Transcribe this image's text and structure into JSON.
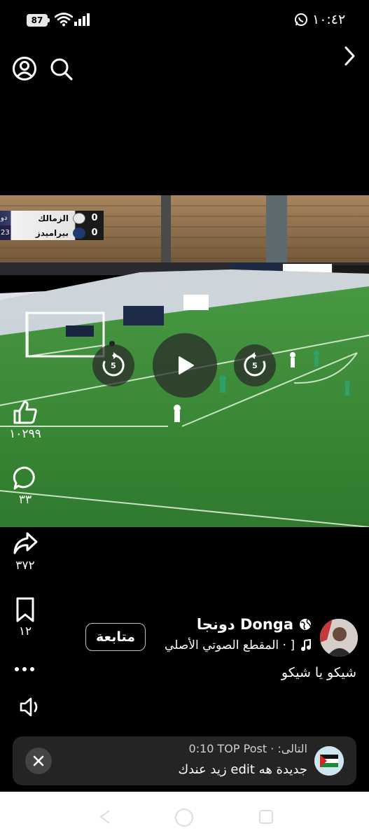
{
  "status_bar": {
    "battery": "87",
    "time": "١٠:٤٢"
  },
  "video": {
    "scoreboard": {
      "teams": [
        {
          "prefix": "دو",
          "name": "الزمالك",
          "score": "0",
          "crest_color": "#e8e8e8"
        },
        {
          "prefix": "23",
          "name": "بيراميدز",
          "score": "0",
          "crest_color": "#1d3b6e"
        }
      ]
    },
    "rewind_seconds": "5",
    "forward_seconds": "5"
  },
  "actions": {
    "likes": "١٠٢٩٩",
    "comments": "٣٣",
    "shares": "٣٧٢",
    "saves": "١٢"
  },
  "post": {
    "author": "دونجا Donga",
    "audio": "المقطع الصوتي الأصلي · ]",
    "follow_label": "متابعة",
    "caption": "شيكو يا شيكو"
  },
  "up_next": {
    "meta": "0:10  TOP Post · :التالى",
    "title": "زيد عندك edit جديدة هه"
  },
  "colors": {
    "background": "#000000",
    "card": "#242424",
    "pitch": "#3d8a3a"
  }
}
